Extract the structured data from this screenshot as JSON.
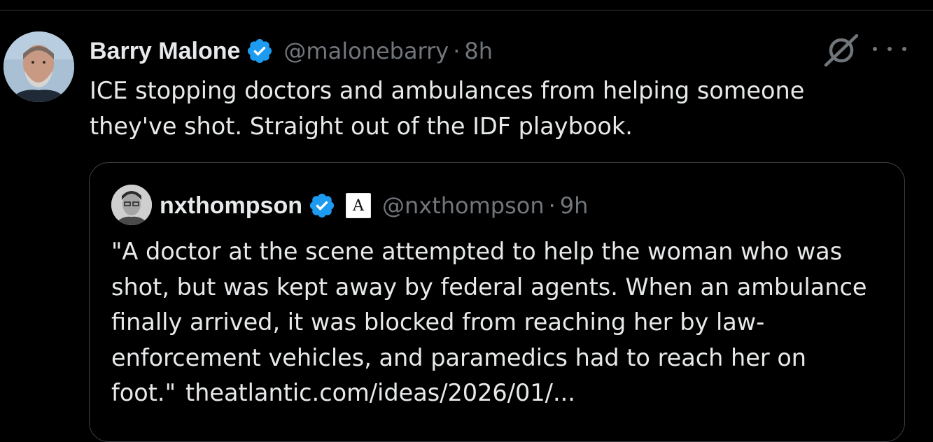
{
  "tweet": {
    "author": {
      "display_name": "Barry Malone",
      "handle": "@malonebarry",
      "verified": true
    },
    "separator": "·",
    "time": "8h",
    "text_lines": [
      "ICE stopping doctors and ambulances from helping someone",
      "they've shot. Straight out of the IDF playbook."
    ],
    "icons": {
      "grok": "grok-icon",
      "more": "more-options-icon"
    }
  },
  "quote": {
    "author": {
      "display_name": "nxthompson",
      "handle": "@nxthompson",
      "verified": true,
      "affiliation_badge": "A"
    },
    "separator": "·",
    "time": "9h",
    "text_lines": [
      "\"A doctor at the scene attempted to help the woman who was",
      "shot, but was kept away by federal agents. When an ambulance",
      "finally arrived, it was blocked from reaching her by law-",
      "enforcement vehicles, and paramedics had to reach her on",
      "foot.\""
    ],
    "link_text": "theatlantic.com/ideas/2026/01/..."
  },
  "colors": {
    "background": "#000000",
    "text": "#e7e9ea",
    "secondary_text": "#71767b",
    "verified_blue": "#1d9bf0",
    "border": "#3e4144"
  }
}
